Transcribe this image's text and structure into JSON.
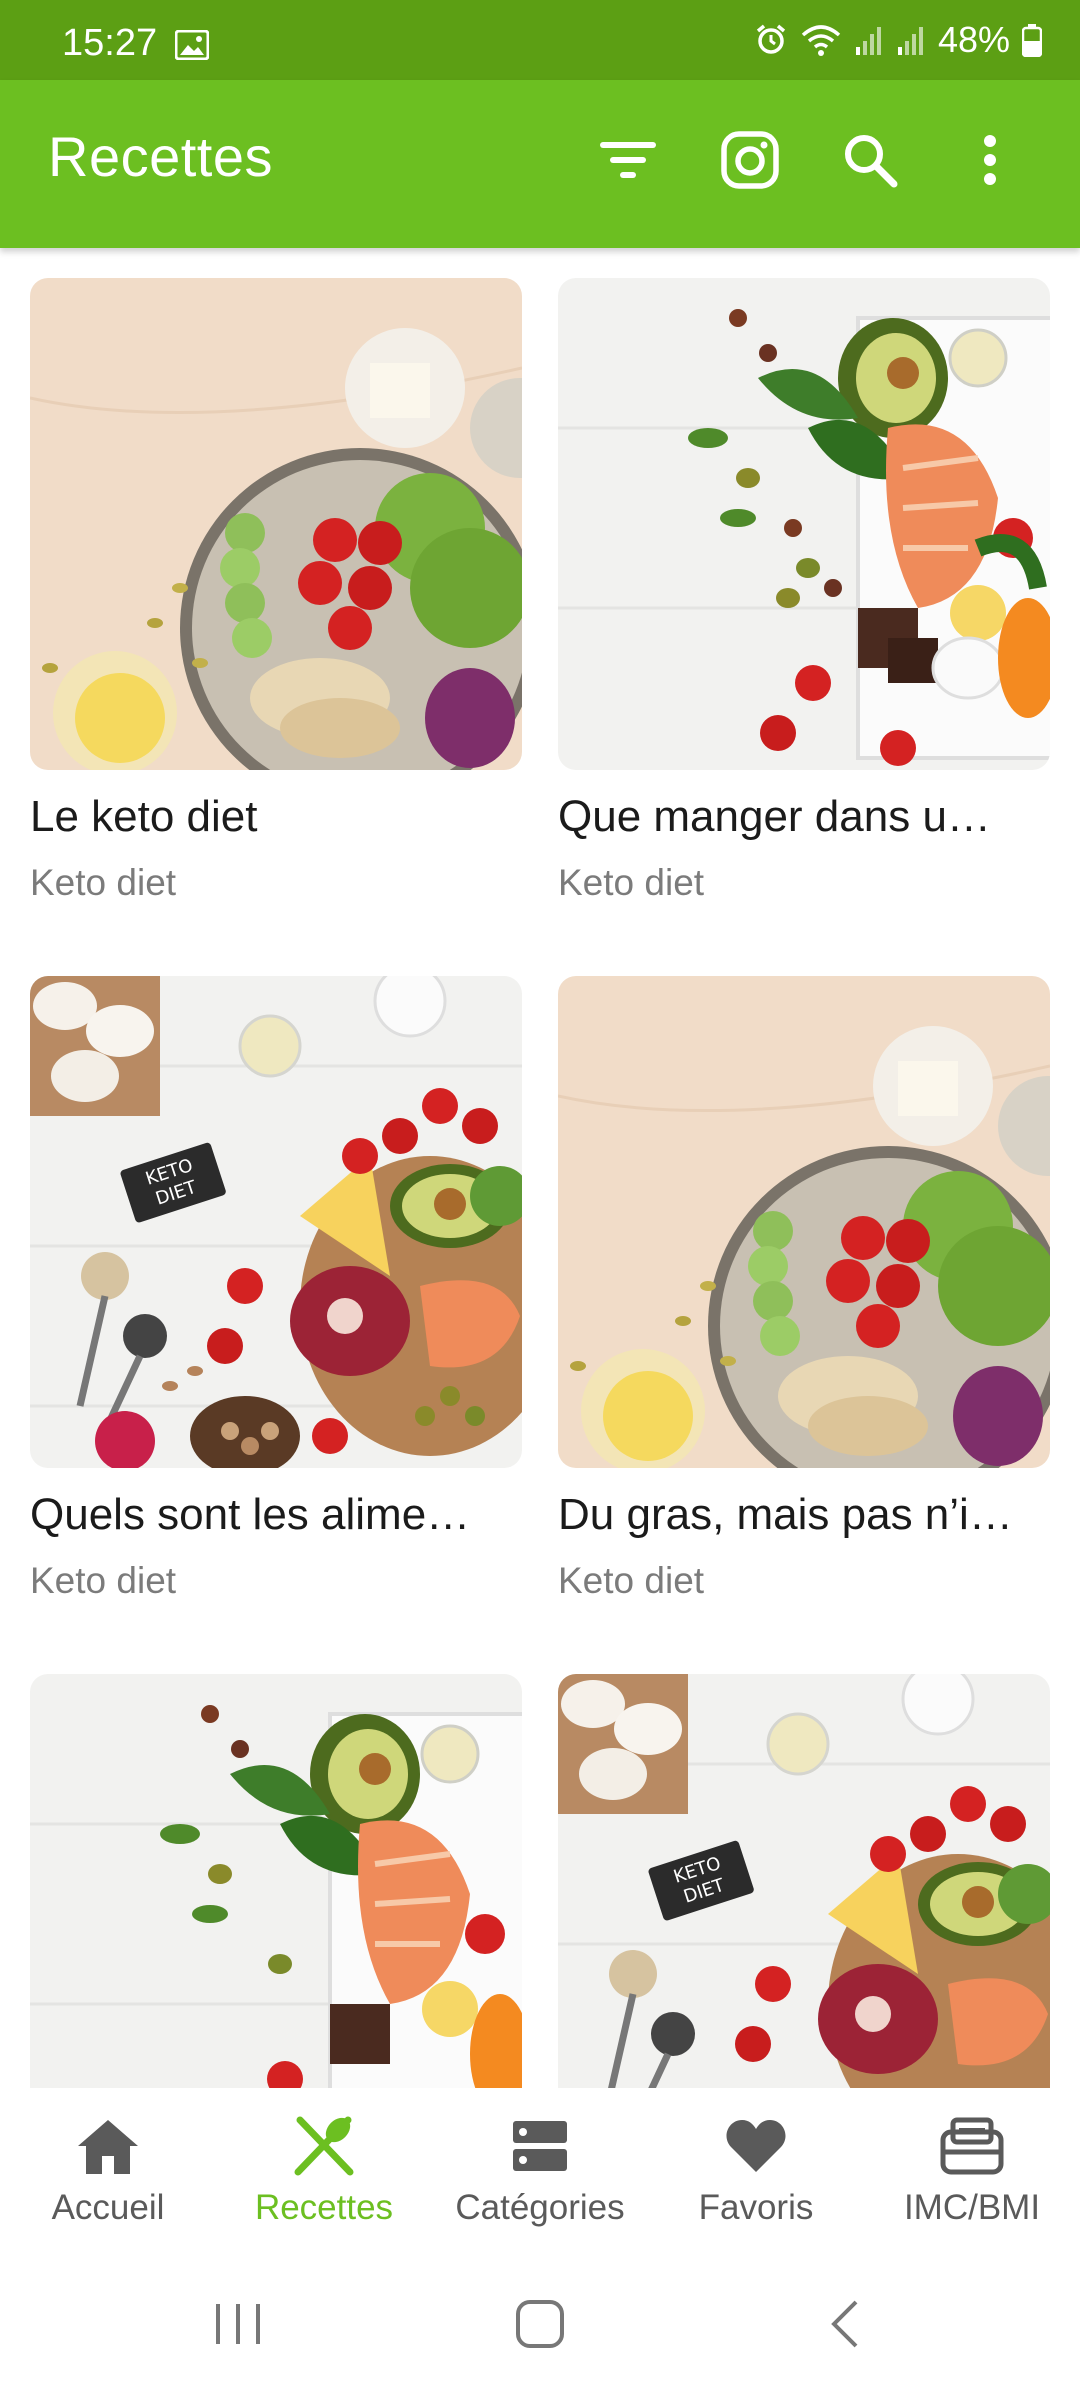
{
  "status_bar": {
    "time": "15:27",
    "battery": "48%",
    "icons": [
      "gallery-icon",
      "alarm-icon",
      "wifi-icon",
      "signal-icon",
      "signal-icon",
      "battery-icon"
    ]
  },
  "app_bar": {
    "title": "Recettes",
    "actions": [
      "filter-icon",
      "instagram-icon",
      "search-icon",
      "more-icon"
    ]
  },
  "recipes": [
    {
      "title": "Le keto diet",
      "category": "Keto diet",
      "image": "salad-bowl-beige"
    },
    {
      "title": "Que manger dans u…",
      "category": "Keto diet",
      "image": "salmon-avocado-tray"
    },
    {
      "title": "Quels sont les alime…",
      "category": "Keto diet",
      "image": "keto-board"
    },
    {
      "title": "Du gras, mais pas n’i…",
      "category": "Keto diet",
      "image": "salad-bowl-beige"
    },
    {
      "title": "",
      "category": "",
      "image": "salmon-avocado-tray"
    },
    {
      "title": "",
      "category": "",
      "image": "keto-board"
    }
  ],
  "bottom_nav": {
    "items": [
      {
        "label": "Accueil",
        "icon": "home-icon",
        "active": false
      },
      {
        "label": "Recettes",
        "icon": "fork-knife-icon",
        "active": true
      },
      {
        "label": "Catégories",
        "icon": "categories-icon",
        "active": false
      },
      {
        "label": "Favoris",
        "icon": "heart-icon",
        "active": false
      },
      {
        "label": "IMC/BMI",
        "icon": "scale-icon",
        "active": false
      }
    ]
  },
  "system_nav": [
    "recent-apps-icon",
    "home-button-icon",
    "back-icon"
  ],
  "colors": {
    "status_bar": "#5c9f14",
    "app_bar": "#6cbf21",
    "active": "#6cbf21",
    "inactive": "#5a5a5a"
  }
}
